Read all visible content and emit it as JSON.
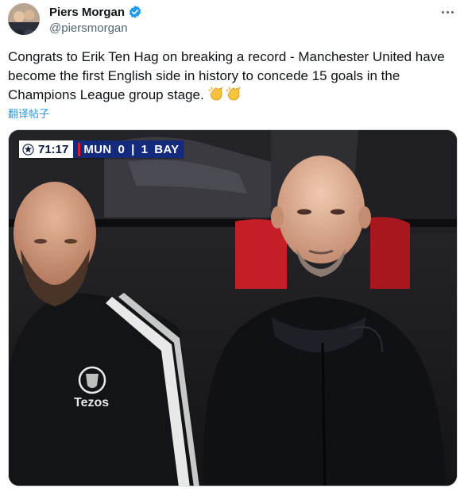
{
  "author": {
    "name": "Piers Morgan",
    "handle": "@piersmorgan",
    "verified": true
  },
  "tweet": {
    "text": "Congrats to Erik Ten Hag on  breaking a record - Manchester United have become the first English side in history to concede 15 goals in the Champions League group stage.",
    "emoji": [
      "clapping-hands",
      "clapping-hands"
    ],
    "translate_label": "翻译帖子"
  },
  "scorebug": {
    "clock": "71:17",
    "home": "MUN",
    "home_score": "0",
    "separator": "|",
    "away_score": "1",
    "away": "BAY"
  },
  "jacket_sponsor": "Tezos",
  "colors": {
    "link": "#1d9bf0",
    "handle": "#536471",
    "verified": "#1d9bf0",
    "scorebug_blue": "#142a7c",
    "united_red": "#da1b2b"
  },
  "icons": [
    "verified-badge-icon",
    "more-options-icon",
    "champions-league-ball-icon",
    "clapping-hands-icon"
  ]
}
